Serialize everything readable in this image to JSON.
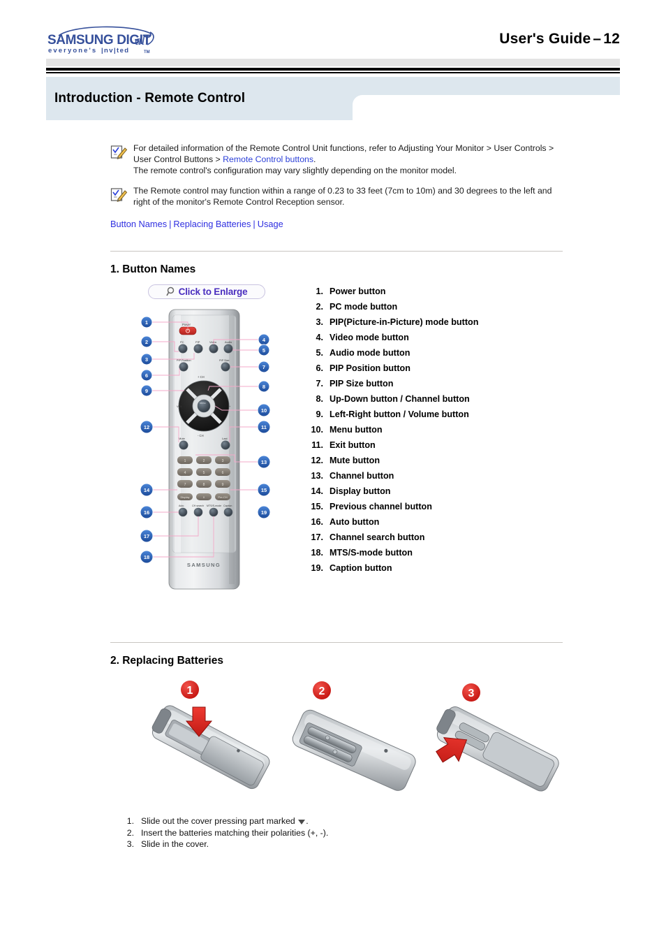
{
  "header": {
    "logo_brand": "SAMSUNG",
    "logo_digitall": "DIGIT",
    "logo_digitall_script": "all",
    "logo_tagline": "everyone's  invited",
    "logo_tm": "TM",
    "guide_label": "User's Guide",
    "guide_dash": "–",
    "page_number": "12",
    "page_title": "Introduction - Remote Control",
    "colors": {
      "logo_blue": "#36509b",
      "title_band": "#dde7ee",
      "gray_band": "#e3e3e3",
      "rule": "#000000"
    }
  },
  "notes": [
    {
      "icon": "note-checklist-icon",
      "text_before_link": "For detailed information of the Remote Control Unit functions, refer to Adjusting Your Monitor > User Controls > User Control Buttons > ",
      "link_text": "Remote Control buttons",
      "text_after_link": ".",
      "second_line": "The remote control's configuration may vary slightly depending on the monitor model."
    },
    {
      "icon": "note-checklist-icon",
      "text_before_link": "The Remote control may function within a range of 0.23 to 33 feet (7cm to 10m) and 30 degrees to the left and right of the monitor's Remote Control Reception sensor.",
      "link_text": "",
      "text_after_link": "",
      "second_line": ""
    }
  ],
  "anchor_links": {
    "items": [
      "Button Names",
      "Replacing Batteries",
      "Usage"
    ],
    "separator": "|",
    "color": "#2f2fe0"
  },
  "sections": {
    "button_names": {
      "heading": "1. Button Names",
      "figure": {
        "enlarge_label": "Click to Enlarge",
        "brand_on_remote": "SAMSUNG",
        "callout_numbers": [
          1,
          2,
          3,
          4,
          5,
          6,
          7,
          8,
          9,
          10,
          11,
          12,
          13,
          14,
          15,
          16,
          17,
          18,
          19
        ],
        "keypad_digits": [
          "1",
          "2",
          "3",
          "4",
          "5",
          "6",
          "7",
          "8",
          "9"
        ],
        "button_captions": [
          "Power",
          "PC",
          "PIP",
          "Video",
          "Audio",
          "PIP Position",
          "PIP Size",
          "Mute",
          "Last",
          "Menu",
          "Exit",
          "Auto",
          "CH search",
          "MTS/S-mode",
          "Caption",
          "+ CH",
          "- CH",
          "- VOL +",
          "Display",
          "Pre-CH"
        ]
      },
      "items": [
        {
          "num": "1.",
          "label": "Power button"
        },
        {
          "num": "2.",
          "label": "PC mode button"
        },
        {
          "num": "3.",
          "label": "PIP(Picture-in-Picture) mode button"
        },
        {
          "num": "4.",
          "label": "Video mode button"
        },
        {
          "num": "5.",
          "label": "Audio mode button"
        },
        {
          "num": "6.",
          "label": "PIP Position button"
        },
        {
          "num": "7.",
          "label": "PIP Size button"
        },
        {
          "num": "8.",
          "label": "Up-Down button / Channel button"
        },
        {
          "num": "9.",
          "label": "Left-Right button / Volume button"
        },
        {
          "num": "10.",
          "label": "Menu button"
        },
        {
          "num": "11.",
          "label": "Exit button"
        },
        {
          "num": "12.",
          "label": "Mute button"
        },
        {
          "num": "13.",
          "label": "Channel button"
        },
        {
          "num": "14.",
          "label": "Display button"
        },
        {
          "num": "15.",
          "label": "Previous channel button"
        },
        {
          "num": "16.",
          "label": "Auto button"
        },
        {
          "num": "17.",
          "label": "Channel search button"
        },
        {
          "num": "18.",
          "label": "MTS/S-mode button"
        },
        {
          "num": "19.",
          "label": "Caption button"
        }
      ]
    },
    "replacing_batteries": {
      "heading": "2. Replacing Batteries",
      "figures": [
        {
          "badge": "1",
          "alt": "remote-cover-slide-out"
        },
        {
          "badge": "2",
          "alt": "remote-batteries-inserted"
        },
        {
          "badge": "3",
          "alt": "remote-cover-slide-in"
        }
      ],
      "steps": [
        {
          "num": "1.",
          "text_before": "Slide out the cover pressing part marked ",
          "marker": "▼",
          "text_after": "."
        },
        {
          "num": "2.",
          "text_before": "Insert the batteries matching their polarities (+, -).",
          "marker": "",
          "text_after": ""
        },
        {
          "num": "3.",
          "text_before": "Slide in the cover.",
          "marker": "",
          "text_after": ""
        }
      ]
    }
  }
}
